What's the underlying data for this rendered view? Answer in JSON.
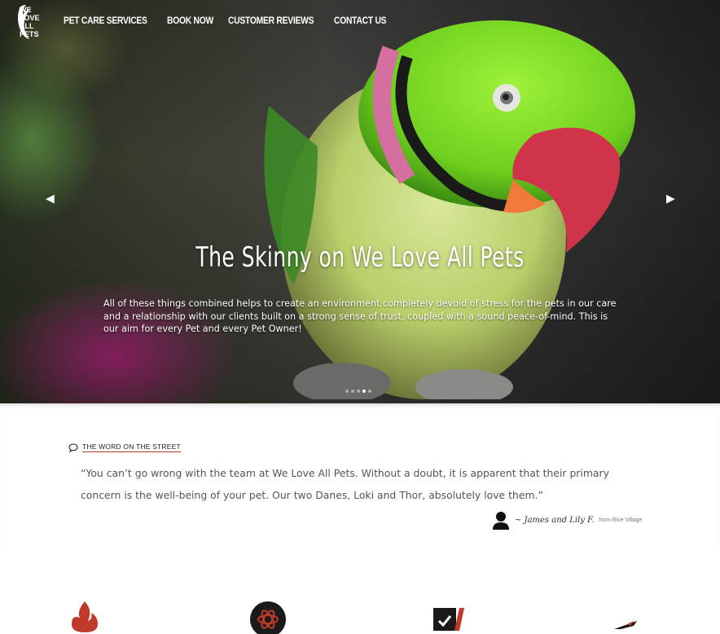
{
  "brand": {
    "logo_text": "WE LOVE ALL PETS",
    "logo_lines": [
      "WE",
      "LOVE",
      "ALL",
      "PETS"
    ]
  },
  "nav": {
    "items": [
      {
        "label": "PET CARE SERVICES"
      },
      {
        "label": "BOOK NOW"
      },
      {
        "label": "CUSTOMER REVIEWS"
      },
      {
        "label": "CONTACT US"
      }
    ]
  },
  "hero": {
    "title": "The Skinny on We Love All Pets",
    "body": "All of these things combined helps to create an environment completely devoid of stress for the pets in our care and a relationship with our clients built on a strong sense of trust, coupled with a sound peace-of-mind. This is our aim for every Pet and every Pet Owner!",
    "prev_icon": "chevron-left-icon",
    "next_icon": "chevron-right-icon",
    "slides_total": 5,
    "active_slide": 4
  },
  "testimonial": {
    "section_label": "THE WORD ON THE STREET",
    "quote": "“You can’t go wrong with the team at We Love All Pets. Without a doubt, it is apparent that their primary concern is the well-being of your pet. Our two Danes, Loki and Thor, absolutely love them.”",
    "author": "~ James and Lily F.",
    "location": "from Rice Village"
  },
  "features": {
    "icons": [
      "flame-icon",
      "atom-badge-icon",
      "shield-check-icon",
      "airplane-icon"
    ]
  },
  "colors": {
    "accent": "#c0392b",
    "parrot_green": "#7ed321",
    "beak_red": "#d0344a"
  }
}
